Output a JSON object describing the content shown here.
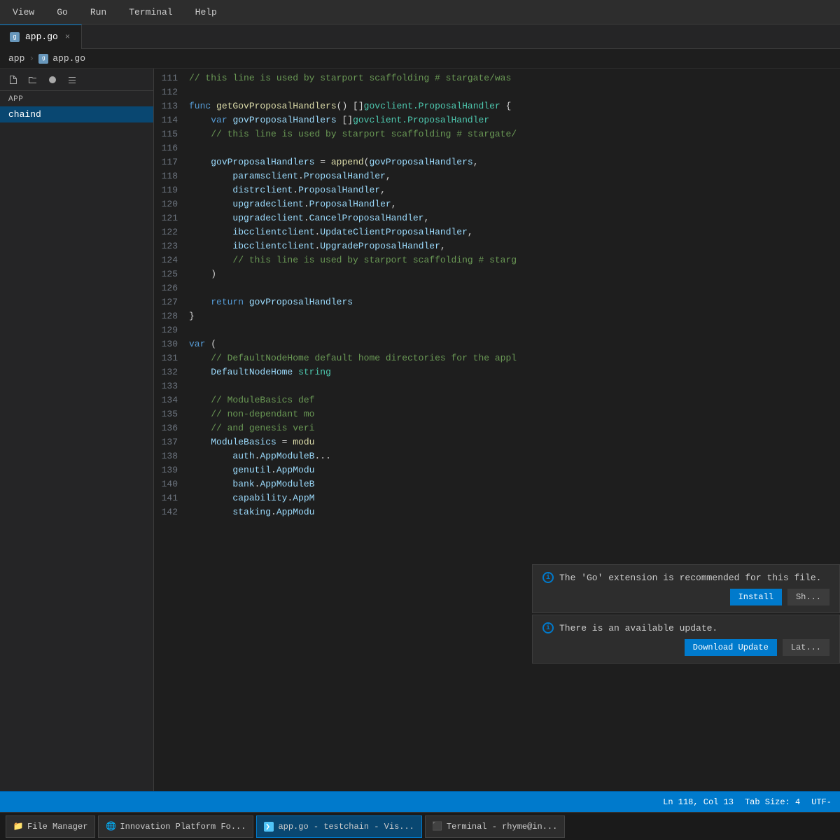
{
  "menuBar": {
    "items": [
      "View",
      "Go",
      "Run",
      "Terminal",
      "Help"
    ]
  },
  "tabBar": {
    "activeTab": "app.go",
    "tabs": [
      {
        "id": "app-go",
        "label": "app.go",
        "closable": true
      }
    ]
  },
  "breadcrumb": {
    "parts": [
      "app",
      "app.go"
    ]
  },
  "sidebar": {
    "label": "app",
    "activeItem": "chaind",
    "items": [
      "chaind"
    ],
    "toolbarIcons": [
      "new-file",
      "new-folder",
      "refresh",
      "collapse-all"
    ]
  },
  "editor": {
    "lines": [
      {
        "num": "111",
        "content": "// this line is used by starport scaffolding # stargate/was"
      },
      {
        "num": "112",
        "content": ""
      },
      {
        "num": "113",
        "content": "func getGovProposalHandlers() []govclient.ProposalHandler {"
      },
      {
        "num": "114",
        "content": "    var govProposalHandlers []govclient.ProposalHandler"
      },
      {
        "num": "115",
        "content": "    // this line is used by starport scaffolding # stargate/"
      },
      {
        "num": "116",
        "content": ""
      },
      {
        "num": "117",
        "content": "    govProposalHandlers = append(govProposalHandlers,"
      },
      {
        "num": "118",
        "content": "        paramsclient.ProposalHandler,"
      },
      {
        "num": "119",
        "content": "        distrclient.ProposalHandler,"
      },
      {
        "num": "120",
        "content": "        upgradeclient.ProposalHandler,"
      },
      {
        "num": "121",
        "content": "        upgradeclient.CancelProposalHandler,"
      },
      {
        "num": "122",
        "content": "        ibcclientclient.UpdateClientProposalHandler,"
      },
      {
        "num": "123",
        "content": "        ibcclientclient.UpgradeProposalHandler,"
      },
      {
        "num": "124",
        "content": "        // this line is used by starport scaffolding # starg"
      },
      {
        "num": "125",
        "content": "    )"
      },
      {
        "num": "126",
        "content": ""
      },
      {
        "num": "127",
        "content": "    return govProposalHandlers"
      },
      {
        "num": "128",
        "content": "}"
      },
      {
        "num": "129",
        "content": ""
      },
      {
        "num": "130",
        "content": "var ("
      },
      {
        "num": "131",
        "content": "    // DefaultNodeHome default home directories for the appl"
      },
      {
        "num": "132",
        "content": "    DefaultNodeHome string"
      },
      {
        "num": "133",
        "content": ""
      },
      {
        "num": "134",
        "content": "    // ModuleBasics def"
      },
      {
        "num": "135",
        "content": "    // non-dependant mo"
      },
      {
        "num": "136",
        "content": "    // and genesis veri"
      },
      {
        "num": "137",
        "content": "    ModuleBasics = modu"
      },
      {
        "num": "138",
        "content": "        auth.AppModuleB..."
      },
      {
        "num": "139",
        "content": "        genutil.AppModu"
      },
      {
        "num": "140",
        "content": "        bank.AppModuleB"
      },
      {
        "num": "141",
        "content": "        capability.AppM"
      },
      {
        "num": "142",
        "content": "        staking.AppModu"
      }
    ]
  },
  "notifications": {
    "goExtension": {
      "message": "The 'Go' extension is recommended for this file.",
      "installBtn": "Install",
      "showBtn": "Sh..."
    },
    "updateAvailable": {
      "message": "There is an available update.",
      "downloadBtn": "Download Update",
      "laterBtn": "Lat..."
    }
  },
  "statusBar": {
    "position": "Ln 118, Col 13",
    "tabSize": "Tab Size: 4",
    "encoding": "UTF-"
  },
  "taskbar": {
    "items": [
      {
        "id": "file-manager",
        "label": "File Manager"
      },
      {
        "id": "innovation-platform",
        "label": "Innovation Platform Fo..."
      },
      {
        "id": "app-go-testchain",
        "label": "app.go - testchain - Vis...",
        "active": true
      },
      {
        "id": "terminal-rhyme",
        "label": "Terminal - rhyme@in..."
      }
    ]
  }
}
